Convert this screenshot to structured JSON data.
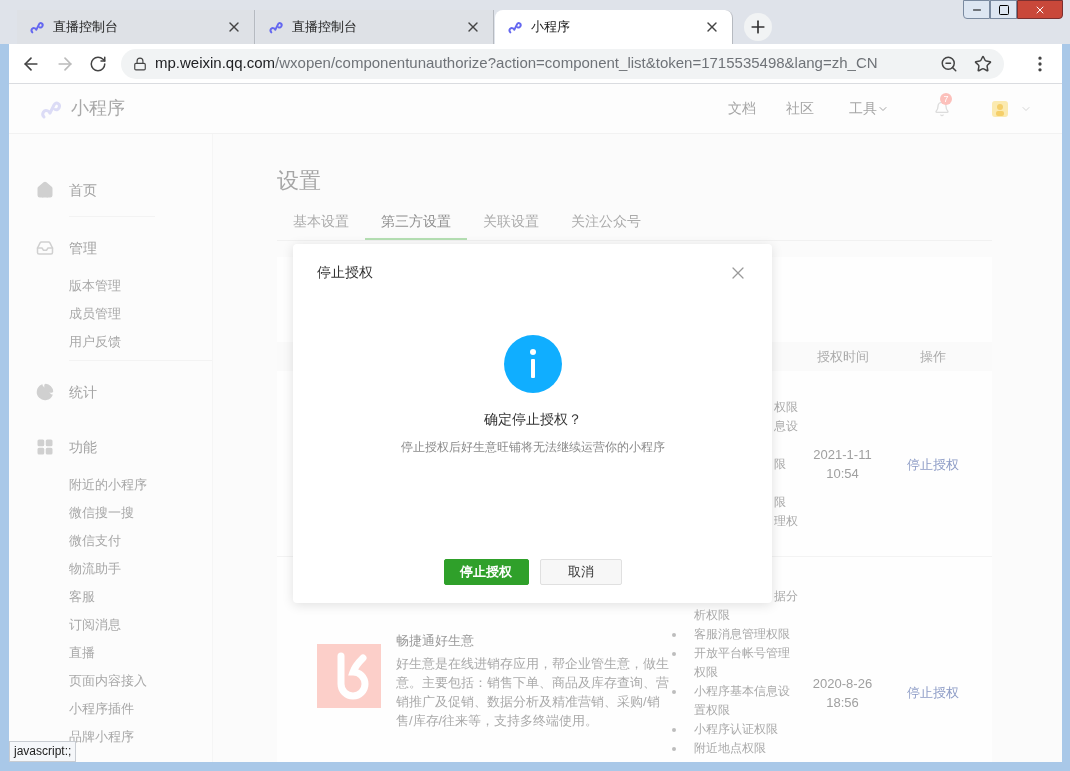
{
  "browser": {
    "tabs": [
      {
        "title": "直播控制台",
        "selected": false
      },
      {
        "title": "直播控制台",
        "selected": false
      },
      {
        "title": "小程序",
        "selected": true
      }
    ],
    "url_host": "mp.weixin.qq.com",
    "url_path": "/wxopen/componentunauthorize?action=component_list&token=1715535498&lang=zh_CN"
  },
  "header": {
    "logo": "小程序",
    "nav": [
      "文档",
      "社区"
    ],
    "tools": "工具",
    "notification_count": "7"
  },
  "sidebar": {
    "sections": [
      {
        "title": "首页"
      },
      {
        "title": "管理",
        "items": [
          "版本管理",
          "成员管理",
          "用户反馈"
        ]
      },
      {
        "title": "统计"
      },
      {
        "title": "功能",
        "items": [
          "附近的小程序",
          "微信搜一搜",
          "微信支付",
          "物流助手",
          "客服",
          "订阅消息",
          "直播",
          "页面内容接入",
          "小程序插件",
          "品牌小程序"
        ]
      }
    ]
  },
  "page": {
    "title": "设置",
    "tabs": [
      {
        "label": "基本设置",
        "selected": false
      },
      {
        "label": "第三方设置",
        "selected": true
      },
      {
        "label": "关联设置",
        "selected": false
      },
      {
        "label": "关注公众号",
        "selected": false
      }
    ]
  },
  "table": {
    "columns": [
      "授权时间",
      "操作"
    ],
    "rows": [
      {
        "permissions": [
          {
            "kind": "partial",
            "lines": [
              "权限",
              "息设"
            ]
          },
          {
            "kind": "partial",
            "lines": [
              "限"
            ]
          },
          {
            "kind": "partial",
            "lines": [
              "限",
              "理权"
            ]
          }
        ],
        "time": [
          "2021-1-11",
          "10:54"
        ],
        "action": "停止授权"
      },
      {
        "name": "畅捷通好生意",
        "description": "好生意是在线进销存应用，帮企业管生意，做生意。主要包括：销售下单、商品及库存查询、营销推广及促销、数据分析及精准营销、采购/销售/库存/往来等，支持多终端使用。",
        "permissions": [
          {
            "kind": "continued",
            "lines": [
              "据分",
              "析权限"
            ]
          },
          {
            "kind": "item",
            "lines": [
              "客服消息管理权限"
            ]
          },
          {
            "kind": "item",
            "lines": [
              "开放平台帐号管理权限"
            ]
          },
          {
            "kind": "item",
            "lines": [
              "小程序基本信息设置权限"
            ]
          },
          {
            "kind": "item",
            "lines": [
              "小程序认证权限"
            ]
          },
          {
            "kind": "item",
            "lines": [
              "附近地点权限"
            ]
          }
        ],
        "time": [
          "2020-8-26",
          "18:56"
        ],
        "action": "停止授权"
      }
    ]
  },
  "dialog": {
    "title": "停止授权",
    "heading": "确定停止授权？",
    "message": "停止授权后好生意旺铺将无法继续运营你的小程序",
    "buttons": [
      {
        "label": "停止授权",
        "kind": "primary"
      },
      {
        "label": "取消",
        "kind": "default"
      }
    ]
  },
  "status_bar": "javascript:;"
}
